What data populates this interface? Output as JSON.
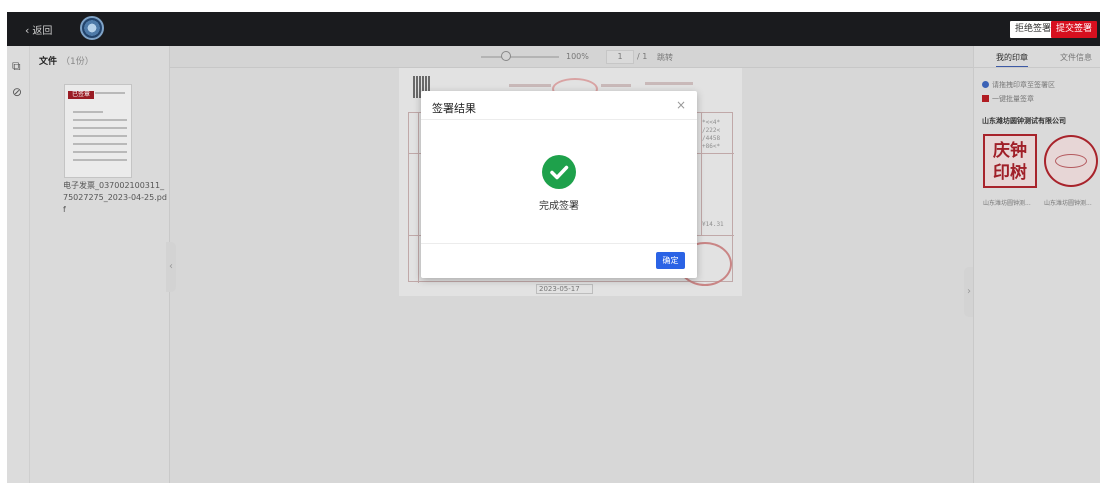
{
  "header": {
    "back_label": "返回",
    "reject_label": "拒绝签署",
    "submit_label": "提交签署"
  },
  "file_panel": {
    "title": "文件",
    "count": "（1份）",
    "thumb_tag": "已签章",
    "file_name": "电子发票_037002100311_75027275_2023-04-25.pdf"
  },
  "doc_toolbar": {
    "zoom": "100%",
    "page_current": "1",
    "page_total": "/ 1",
    "jump_label": "跳转"
  },
  "document": {
    "date": "2023-05-17"
  },
  "right_panel": {
    "tab_mine": "我的印章",
    "tab_info": "文件信息",
    "tip": "请拖拽印章至签署区",
    "check_label": "一键批量签章",
    "company": "山东潍坊圆钟测试有限公司",
    "seal_square_text": "庆钟印树",
    "seals": [
      "山东潍坊圆钟测...",
      "山东潍坊圆钟测..."
    ]
  },
  "modal": {
    "title": "签署结果",
    "result": "完成签署",
    "confirm_label": "确定"
  },
  "colors": {
    "header_bg": "#1a1b1e",
    "submit_red": "#d7101f",
    "success_green": "#1ea14b",
    "primary_blue": "#2b63e5"
  }
}
